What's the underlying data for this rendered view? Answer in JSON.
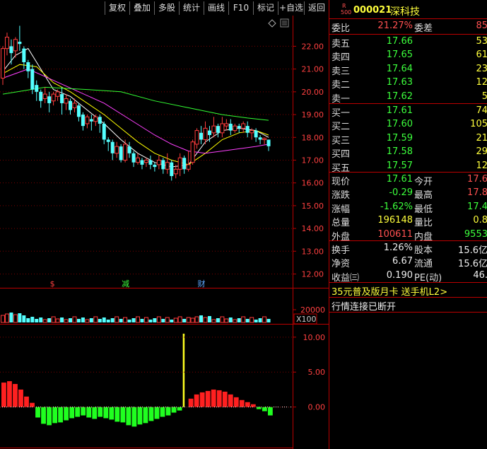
{
  "toolbar": {
    "buttons": [
      "复权",
      "叠加",
      "多股",
      "统计",
      "画线",
      "F10",
      "标记",
      "+自选",
      "返回"
    ]
  },
  "stock": {
    "badge_top": "R",
    "badge_bottom": "500",
    "code": "000021",
    "name": "深科技"
  },
  "order_ratio": {
    "label1": "委比",
    "value1": "21.27%",
    "label2": "委差",
    "value2": "85"
  },
  "asks": [
    {
      "label": "卖五",
      "price": "17.66",
      "vol": "53"
    },
    {
      "label": "卖四",
      "price": "17.65",
      "vol": "61"
    },
    {
      "label": "卖三",
      "price": "17.64",
      "vol": "23"
    },
    {
      "label": "卖二",
      "price": "17.63",
      "vol": "12"
    },
    {
      "label": "卖一",
      "price": "17.62",
      "vol": "5"
    }
  ],
  "bids": [
    {
      "label": "买一",
      "price": "17.61",
      "vol": "74"
    },
    {
      "label": "买二",
      "price": "17.60",
      "vol": "105"
    },
    {
      "label": "买三",
      "price": "17.59",
      "vol": "21"
    },
    {
      "label": "买四",
      "price": "17.58",
      "vol": "29"
    },
    {
      "label": "买五",
      "price": "17.57",
      "vol": "12"
    }
  ],
  "stats1": [
    {
      "l1": "现价",
      "v1": "17.61",
      "c1": "green",
      "l2": "今开",
      "v2": "17.6",
      "c2": "red"
    },
    {
      "l1": "涨跌",
      "v1": "-0.29",
      "c1": "green",
      "l2": "最高",
      "v2": "17.8",
      "c2": "red"
    },
    {
      "l1": "涨幅",
      "v1": "-1.62%",
      "c1": "green",
      "l2": "最低",
      "v2": "17.4",
      "c2": "green"
    },
    {
      "l1": "总量",
      "v1": "196148",
      "c1": "yellow",
      "l2": "量比",
      "v2": "0.8",
      "c2": "yellow"
    },
    {
      "l1": "外盘",
      "v1": "100611",
      "c1": "red",
      "l2": "内盘",
      "v2": "9553",
      "c2": "green"
    }
  ],
  "stats2": [
    {
      "l1": "换手",
      "v1": "1.26%",
      "l2": "股本",
      "v2": "15.6亿"
    },
    {
      "l1": "净资",
      "v1": "6.67",
      "l2": "流通",
      "v2": "15.6亿"
    },
    {
      "l1": "收益㈢",
      "v1": "0.190",
      "l2": "PE(动)",
      "v2": "46."
    }
  ],
  "promo": "35元普及版月卡 送手机L2>",
  "status": "行情连接已断开",
  "chart_data": [
    {
      "type": "candlestick",
      "y_ticks": [
        "22.00",
        "21.00",
        "20.00",
        "19.00",
        "18.00",
        "17.00",
        "16.00",
        "15.00",
        "14.00",
        "13.00",
        "12.00"
      ],
      "ylim": [
        11.55,
        23.1
      ],
      "event_markers": [
        "$",
        "减",
        "财"
      ],
      "candles": [
        [
          20.6,
          21.9,
          20.3,
          22.0
        ],
        [
          21.9,
          22.4,
          21.6,
          22.6
        ],
        [
          22.0,
          21.7,
          21.2,
          22.3
        ],
        [
          21.8,
          22.3,
          21.5,
          22.4
        ],
        [
          22.2,
          22.1,
          21.8,
          22.9
        ],
        [
          21.9,
          21.3,
          21.0,
          22.0
        ],
        [
          21.3,
          20.9,
          20.6,
          21.4
        ],
        [
          21.0,
          20.1,
          19.9,
          21.2
        ],
        [
          20.3,
          20.0,
          19.6,
          20.5
        ],
        [
          20.0,
          19.6,
          19.3,
          20.1
        ],
        [
          19.7,
          19.9,
          19.5,
          20.2
        ],
        [
          19.8,
          19.5,
          19.1,
          20.0
        ],
        [
          19.6,
          19.9,
          19.4,
          20.0
        ],
        [
          19.8,
          20.0,
          19.6,
          20.1
        ],
        [
          19.9,
          19.5,
          19.0,
          20.2
        ],
        [
          19.5,
          19.7,
          19.2,
          19.9
        ],
        [
          19.6,
          19.2,
          19.0,
          19.7
        ],
        [
          19.3,
          19.5,
          19.1,
          19.7
        ],
        [
          19.4,
          18.9,
          18.7,
          19.5
        ],
        [
          19.0,
          18.5,
          18.3,
          19.1
        ],
        [
          18.6,
          18.9,
          18.4,
          19.0
        ],
        [
          18.8,
          18.7,
          18.3,
          19.0
        ],
        [
          18.7,
          18.9,
          18.5,
          19.0
        ],
        [
          18.9,
          18.6,
          18.2,
          19.0
        ],
        [
          18.6,
          17.9,
          17.7,
          18.7
        ],
        [
          17.9,
          17.8,
          17.4,
          18.0
        ],
        [
          17.8,
          17.3,
          17.0,
          17.9
        ],
        [
          17.3,
          17.6,
          17.1,
          17.8
        ],
        [
          17.6,
          17.0,
          16.9,
          17.7
        ],
        [
          17.0,
          17.7,
          16.9,
          17.9
        ],
        [
          17.6,
          17.3,
          17.1,
          17.8
        ],
        [
          17.3,
          16.9,
          16.7,
          17.4
        ],
        [
          16.9,
          17.1,
          16.8,
          17.3
        ],
        [
          17.0,
          16.8,
          16.6,
          17.1
        ],
        [
          16.9,
          17.0,
          16.7,
          17.1
        ],
        [
          17.0,
          16.8,
          16.6,
          17.2
        ],
        [
          16.8,
          16.7,
          16.5,
          16.9
        ],
        [
          16.8,
          17.0,
          16.6,
          17.2
        ],
        [
          17.0,
          16.6,
          16.4,
          17.1
        ],
        [
          16.6,
          16.9,
          16.4,
          17.3
        ],
        [
          16.9,
          16.3,
          16.1,
          17.0
        ],
        [
          16.4,
          16.6,
          16.2,
          16.8
        ],
        [
          16.6,
          17.1,
          16.3,
          17.3
        ],
        [
          17.1,
          16.6,
          16.4,
          17.2
        ],
        [
          16.6,
          16.8,
          16.5,
          17.4
        ],
        [
          16.9,
          17.8,
          16.8,
          17.9
        ],
        [
          17.7,
          18.3,
          17.5,
          18.4
        ],
        [
          18.2,
          17.9,
          17.7,
          18.5
        ],
        [
          17.9,
          18.4,
          17.7,
          18.7
        ],
        [
          18.3,
          18.1,
          17.8,
          18.5
        ],
        [
          18.2,
          18.5,
          18.0,
          18.9
        ],
        [
          18.5,
          18.2,
          18.0,
          18.6
        ],
        [
          18.2,
          18.6,
          18.0,
          18.9
        ],
        [
          18.5,
          18.6,
          18.3,
          18.8
        ],
        [
          18.6,
          18.3,
          18.1,
          18.8
        ],
        [
          18.3,
          18.5,
          18.2,
          18.6
        ],
        [
          18.5,
          18.4,
          18.2,
          18.6
        ],
        [
          18.4,
          18.6,
          18.2,
          18.7
        ],
        [
          18.5,
          18.2,
          18.0,
          18.7
        ],
        [
          18.2,
          18.3,
          17.9,
          18.4
        ],
        [
          18.3,
          18.0,
          17.8,
          18.4
        ],
        [
          18.0,
          17.9,
          17.7,
          18.1
        ],
        [
          17.9,
          17.95,
          17.7,
          18.0
        ],
        [
          17.9,
          17.61,
          17.4,
          17.8
        ]
      ],
      "ma_lines": [
        {
          "name": "MA5",
          "color": "#ffffff",
          "points": [
            [
              0,
              20.9
            ],
            [
              3,
              21.6
            ],
            [
              6,
              21.9
            ],
            [
              9,
              21.0
            ],
            [
              12,
              20.1
            ],
            [
              16,
              19.8
            ],
            [
              20,
              19.2
            ],
            [
              24,
              18.6
            ],
            [
              28,
              17.9
            ],
            [
              32,
              17.3
            ],
            [
              36,
              16.9
            ],
            [
              40,
              16.7
            ],
            [
              44,
              16.8
            ],
            [
              48,
              17.8
            ],
            [
              52,
              18.3
            ],
            [
              56,
              18.4
            ],
            [
              60,
              18.3
            ],
            [
              63,
              18.0
            ]
          ]
        },
        {
          "name": "MA10",
          "color": "#ffff00",
          "points": [
            [
              0,
              20.8
            ],
            [
              4,
              21.2
            ],
            [
              8,
              21.1
            ],
            [
              12,
              20.4
            ],
            [
              16,
              20.0
            ],
            [
              20,
              19.5
            ],
            [
              24,
              19.0
            ],
            [
              28,
              18.4
            ],
            [
              32,
              17.8
            ],
            [
              36,
              17.3
            ],
            [
              40,
              17.0
            ],
            [
              44,
              16.8
            ],
            [
              48,
              17.3
            ],
            [
              52,
              17.9
            ],
            [
              56,
              18.2
            ],
            [
              60,
              18.3
            ],
            [
              63,
              18.1
            ]
          ]
        },
        {
          "name": "MA20",
          "color": "#ff40ff",
          "points": [
            [
              0,
              20.6
            ],
            [
              6,
              21.0
            ],
            [
              12,
              20.5
            ],
            [
              18,
              20.0
            ],
            [
              24,
              19.5
            ],
            [
              30,
              18.8
            ],
            [
              36,
              18.1
            ],
            [
              40,
              17.7
            ],
            [
              44,
              17.4
            ],
            [
              48,
              17.3
            ],
            [
              52,
              17.4
            ],
            [
              56,
              17.5
            ],
            [
              60,
              17.6
            ],
            [
              63,
              17.7
            ]
          ]
        },
        {
          "name": "MA60",
          "color": "#33ff33",
          "points": [
            [
              0,
              19.9
            ],
            [
              10,
              20.2
            ],
            [
              20,
              20.1
            ],
            [
              28,
              20.0
            ],
            [
              36,
              19.6
            ],
            [
              44,
              19.3
            ],
            [
              52,
              19.0
            ],
            [
              58,
              18.85
            ],
            [
              63,
              18.75
            ]
          ]
        }
      ]
    },
    {
      "type": "bar",
      "unit_label": "X100",
      "y_ticks": [
        "20000"
      ]
    },
    {
      "type": "bar",
      "y_ticks": [
        "10.00",
        "5.00",
        "0.00"
      ],
      "ylim": [
        -5.5,
        11.5
      ],
      "values": [
        3.5,
        3.7,
        3.3,
        2.5,
        1.5,
        0.6,
        -1.5,
        -2.4,
        -2.6,
        -2.3,
        -2.2,
        -1.9,
        -1.6,
        -1.4,
        -1.2,
        -1.5,
        -1.7,
        -1.4,
        -1.6,
        -1.8,
        -2.1,
        -2.2,
        -2.6,
        -2.8,
        -2.5,
        -2.3,
        -2.0,
        -1.7,
        -1.4,
        -1.2,
        -0.8,
        -0.5,
        10.5,
        1.2,
        1.8,
        2.1,
        2.3,
        2.5,
        2.4,
        2.2,
        1.8,
        1.4,
        1.0,
        0.7,
        0.4,
        -0.3,
        -0.6,
        -1.2
      ]
    }
  ]
}
